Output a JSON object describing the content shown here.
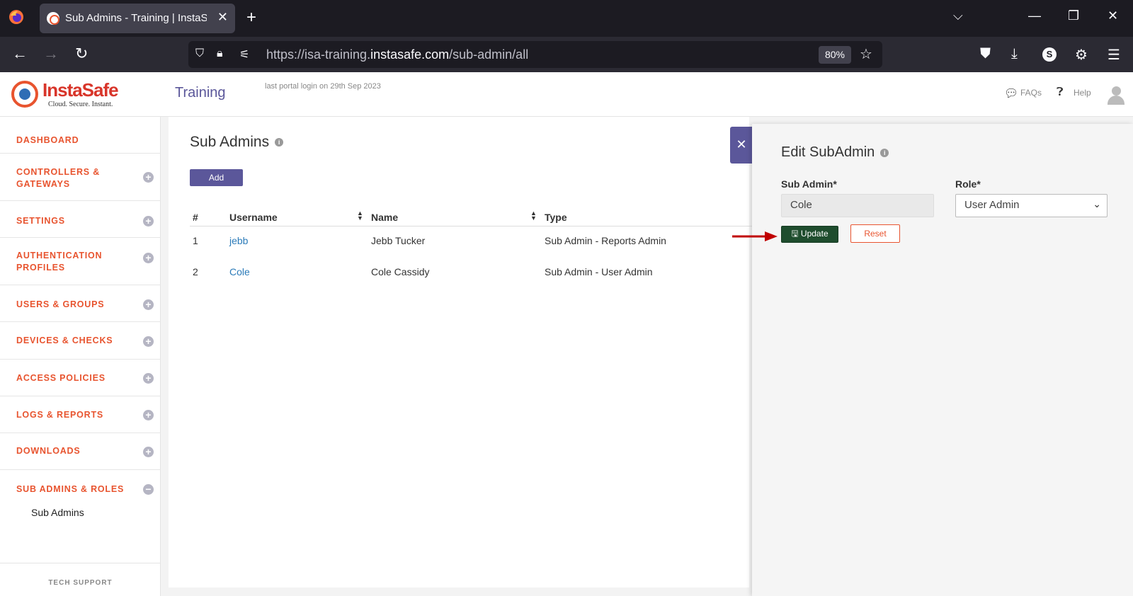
{
  "browser": {
    "tab_title": "Sub Admins - Training | InstaSafe",
    "url_prefix": "https://isa-training.",
    "url_domain": "instasafe.com",
    "url_path": "/sub-admin/all",
    "zoom": "80%",
    "profile_initial": "S"
  },
  "header": {
    "brand": "InstaSafe",
    "tagline": "Cloud. Secure. Instant.",
    "org": "Training",
    "last_login": "last portal login on 29th Sep 2023",
    "faqs": "FAQs",
    "help": "Help"
  },
  "sidebar": {
    "items": [
      {
        "label": "DASHBOARD"
      },
      {
        "label": "CONTROLLERS & GATEWAYS"
      },
      {
        "label": "SETTINGS"
      },
      {
        "label": "AUTHENTICATION PROFILES"
      },
      {
        "label": "USERS & GROUPS"
      },
      {
        "label": "DEVICES & CHECKS"
      },
      {
        "label": "ACCESS POLICIES"
      },
      {
        "label": "LOGS & REPORTS"
      },
      {
        "label": "DOWNLOADS"
      },
      {
        "label": "SUB ADMINS & ROLES"
      }
    ],
    "sub_item": "Sub Admins",
    "tech_support": "TECH SUPPORT"
  },
  "main": {
    "title": "Sub Admins",
    "add_label": "Add",
    "columns": [
      "#",
      "Username",
      "Name",
      "Type"
    ],
    "rows": [
      {
        "num": "1",
        "username": "jebb",
        "name": "Jebb Tucker",
        "type": "Sub Admin - Reports Admin"
      },
      {
        "num": "2",
        "username": "Cole",
        "name": "Cole Cassidy",
        "type": "Sub Admin - User Admin"
      }
    ]
  },
  "drawer": {
    "title": "Edit SubAdmin",
    "sub_admin_label": "Sub Admin*",
    "sub_admin_value": "Cole",
    "role_label": "Role*",
    "role_value": "User Admin",
    "update_label": "Update",
    "reset_label": "Reset"
  },
  "colors": {
    "accent": "#5b579a",
    "sidebar_text": "#e8542f",
    "update_button": "#1f4d2e",
    "arrow": "#c00000"
  }
}
